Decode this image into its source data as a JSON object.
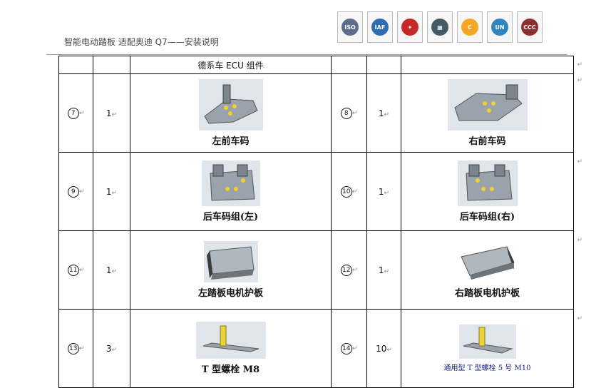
{
  "header": {
    "title": "智能电动踏板 适配奥迪 Q7——安装说明",
    "certs": [
      {
        "icon": "iso-seal-icon",
        "color": "#5b6d8a",
        "label": "ISO"
      },
      {
        "icon": "iaf-icon",
        "color": "#2f6db3",
        "label": "IAF"
      },
      {
        "icon": "cnas-icon",
        "color": "#c62828",
        "label": "✦"
      },
      {
        "icon": "qr-cert-icon",
        "color": "#455a64",
        "label": "▦"
      },
      {
        "icon": "c-mark-icon",
        "color": "#f5a623",
        "label": "C"
      },
      {
        "icon": "un-icon",
        "color": "#2e86c1",
        "label": "UN"
      },
      {
        "icon": "ccc-icon",
        "color": "#8e2f2f",
        "label": "CCC"
      }
    ]
  },
  "table": {
    "heading": "德系车 ECU 组件",
    "rows": [
      {
        "left": {
          "no": "7",
          "qty": "1",
          "name": "左前车码"
        },
        "right": {
          "no": "8",
          "qty": "1",
          "name": "右前车码"
        }
      },
      {
        "left": {
          "no": "9",
          "qty": "1",
          "name": "后车码组(左)"
        },
        "right": {
          "no": "10",
          "qty": "1",
          "name": "后车码组(右)"
        }
      },
      {
        "left": {
          "no": "11",
          "qty": "1",
          "name": "左踏板电机护板"
        },
        "right": {
          "no": "12",
          "qty": "1",
          "name": "右踏板电机护板"
        }
      },
      {
        "left": {
          "no": "13",
          "qty": "3",
          "name": "T 型螺栓 M8"
        },
        "right": {
          "no": "14",
          "qty": "10",
          "name": "通用型 T 型螺栓 5 号 M10"
        }
      }
    ]
  }
}
